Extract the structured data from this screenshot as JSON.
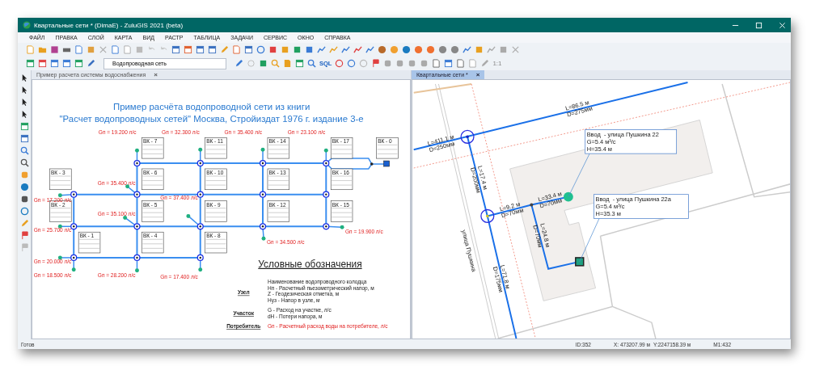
{
  "window": {
    "title": "Квартальные сети * (DimaE) - ZuluGIS 2021 (beta)"
  },
  "menu": [
    "ФАЙЛ",
    "ПРАВКА",
    "СЛОЙ",
    "КАРТА",
    "ВИД",
    "РАСТР",
    "ТАБЛИЦА",
    "ЗАДАЧИ",
    "СЕРВИС",
    "ОКНО",
    "СПРАВКА"
  ],
  "toolbar": {
    "layer_combo": "Водопроводная сеть",
    "text_buttons": [
      "SQL",
      "1:1"
    ]
  },
  "left_pane": {
    "tab": {
      "label": "Пример расчета системы водоснабжения",
      "close": "×",
      "selected": false
    },
    "title_lines": [
      "Пример расчёта водопроводной сети из книги",
      "\"Расчет водопроводных сетей\" Москва, Стройиздат 1976 г. издание 3-е"
    ],
    "nodes": [
      "ВК - 7",
      "ВК - 11",
      "ВК - 14",
      "ВК - 17",
      "ВК - 0",
      "ВК - 3",
      "ВК - 6",
      "ВК - 10",
      "ВК - 13",
      "ВК - 16",
      "ВК - 2",
      "ВК - 5",
      "ВК - 9",
      "ВК - 12",
      "ВК - 15",
      "ВК - 1",
      "ВК - 4",
      "ВК - 8"
    ],
    "consumers": [
      "Gп = 19.200 л/с",
      "Gп = 32.300 л/с",
      "Gп = 35.400 л/с",
      "Gп = 23.100 л/с",
      "Gп = 17.200 л/с",
      "Gп = 35.400 л/с",
      "Gп = 35.100 л/с",
      "Gп = 37.400 л/с",
      "Gп = 25.700 л/с",
      "Gп = 19.900 л/с",
      "Gп = 34.500 л/с",
      "Gп = 20.000 л/с",
      "Gп = 18.500 л/с",
      "Gп = 28.200 л/с",
      "Gп = 17.400 л/с"
    ],
    "legend": {
      "heading": "Условные обозначения",
      "groups": [
        {
          "kind": "node",
          "label": "Узел",
          "lines": [
            "Наименование водопроводного колодца",
            "Нп - Расчетный пьезометрический напор, м",
            "Z - Геодезическая отметка, м",
            "Нуз - Напор в узле, м"
          ]
        },
        {
          "kind": "segment",
          "label": "Участок",
          "lines": [
            "G - Расход на участке, л/с",
            "dH - Потери напора, м"
          ]
        },
        {
          "kind": "consumer",
          "label": "Потребитель",
          "lines": [
            "Gп - Расчетный расход воды на потребителе, л/с"
          ]
        }
      ]
    }
  },
  "right_pane": {
    "tab": {
      "label": "Квартальные сети *",
      "close": "×",
      "selected": true
    },
    "segments": [
      {
        "length": "L=86.5 м",
        "diameter": "D=275мм"
      },
      {
        "length": "L=411.1 м",
        "diameter": "D=250мм"
      },
      {
        "length": "L=17.4 м",
        "diameter": "D=200мм"
      },
      {
        "length": "L=9.2 м",
        "diameter": "D=70мм"
      },
      {
        "length": "L=33.4 м",
        "diameter": "D=70мм"
      },
      {
        "length": "L=24.8 м",
        "diameter": "D=70мм"
      },
      {
        "length": "L=71.8 м",
        "diameter": "D=175мм"
      }
    ],
    "street": "улица Пушкина",
    "callouts": [
      {
        "lines": [
          "Ввод  - улица Пушкина 22",
          "G=5.4 м³/с",
          "H=35.4 м"
        ]
      },
      {
        "lines": [
          "Ввод  - улица Пушкина 22а",
          "G=5.4 м³/с",
          "H=35.3 м"
        ]
      }
    ]
  },
  "status_bar": {
    "message": "Готов",
    "id": "ID:352",
    "x": "X: 473207.99 м",
    "y": "Y:2247158.39 м",
    "scale": "M1:432"
  }
}
